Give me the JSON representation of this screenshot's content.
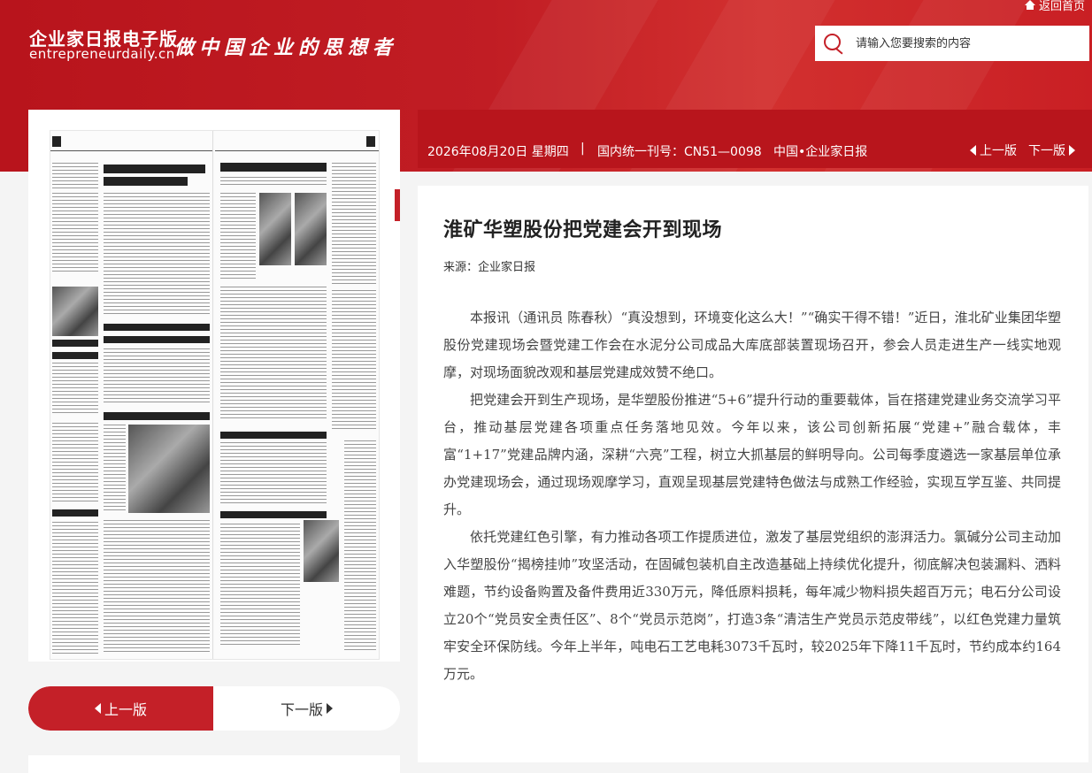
{
  "header": {
    "site_name": "企业家日报电子版",
    "domain": "entrepreneurdaily.cn",
    "slogan": "做中国企业的思想者",
    "home_link": "返回首页",
    "search_placeholder": "请输入您要搜索的内容"
  },
  "info_bar": {
    "date": "2026年08月20日 星期四",
    "separator": "|",
    "serial": "国内统一刊号：CN51—0098",
    "publisher": "中国•企业家日报",
    "prev": "上一版",
    "next": "下一版"
  },
  "left_pager": {
    "prev": "上一版",
    "next": "下一版"
  },
  "article": {
    "title": "淮矿华塑股份把党建会开到现场",
    "source": "来源：企业家日报",
    "paragraphs": [
      "本报讯（通讯员 陈春秋）“真没想到，环境变化这么大！”“确实干得不错！”近日，淮北矿业集团华塑股份党建现场会暨党建工作会在水泥分公司成品大库底部装置现场召开，参会人员走进生产一线实地观摩，对现场面貌改观和基层党建成效赞不绝口。",
      "把党建会开到生产现场，是华塑股份推进“5+6”提升行动的重要载体，旨在搭建党建业务交流学习平台，推动基层党建各项重点任务落地见效。今年以来，该公司创新拓展“党建+”融合载体，丰富“1+17”党建品牌内涵，深耕“六亮”工程，树立大抓基层的鲜明导向。公司每季度遴选一家基层单位承办党建现场会，通过现场观摩学习，直观呈现基层党建特色做法与成熟工作经验，实现互学互鉴、共同提升。",
      "依托党建红色引擎，有力推动各项工作提质进位，激发了基层党组织的澎湃活力。氯碱分公司主动加入华塑股份“揭榜挂帅”攻坚活动，在固碱包装机自主改造基础上持续优化提升，彻底解决包装漏料、洒料难题，节约设备购置及备件费用近330万元，降低原料损耗，每年减少物料损失超百万元；电石分公司设立20个“党员安全责任区”、8个“党员示范岗”，打造3条“清洁生产党员示范皮带线”，以红色党建力量筑牢安全环保防线。今年上半年，吨电石工艺电耗3073千瓦时，较2025年下降11千瓦时，节约成本约164万元。"
    ]
  },
  "colors": {
    "brand_red": "#c42028",
    "info_bar_red": "#b8151c"
  }
}
